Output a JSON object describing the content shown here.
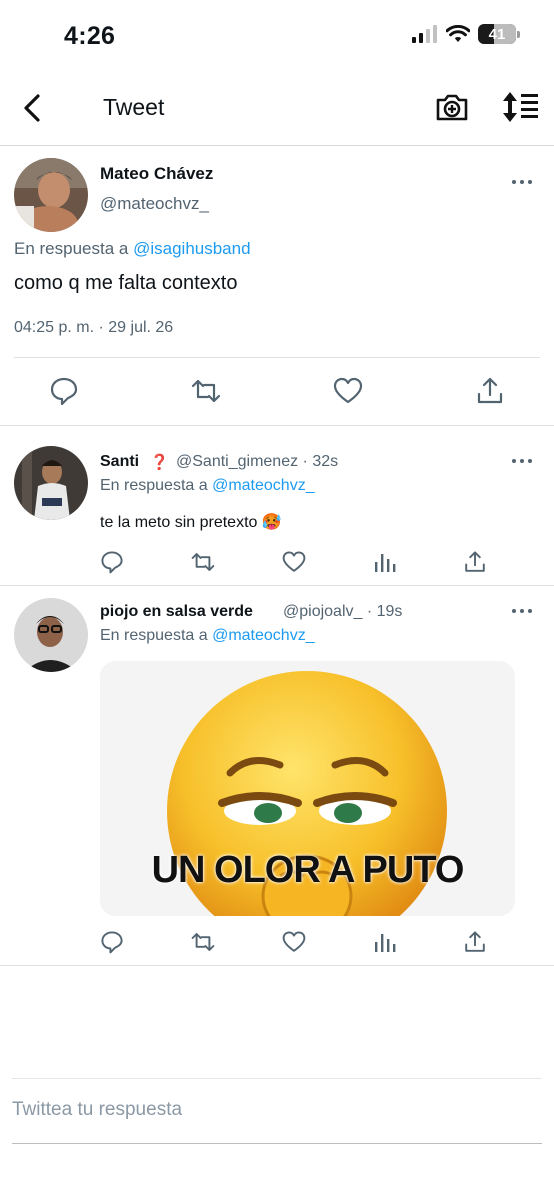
{
  "status_bar": {
    "time": "4:26",
    "battery": "41",
    "battery_level": 0.41
  },
  "nav": {
    "title": "Tweet",
    "icons": [
      "back-arrow-icon",
      "camera-plus-icon",
      "sort-icon"
    ]
  },
  "main_tweet": {
    "name": "Mateo Chávez",
    "handle": "@mateochvz_",
    "reply_prefix": "En respuesta a",
    "reply_to": "@isagihusband",
    "text": "como q me falta contexto",
    "timestamp": "04:25 p. m. · 29 jul. 26"
  },
  "replies": [
    {
      "name": "Santi",
      "badge": "❓",
      "handle": "@Santi_gimenez",
      "time": "· 32s",
      "reply_prefix": "En respuesta a",
      "reply_to": "@mateochvz_",
      "text": "te la meto sin pretexto 🥵"
    },
    {
      "name": "piojo en salsa verde",
      "handle": "@piojoalv_",
      "time": "· 19s",
      "reply_prefix": "En respuesta a",
      "reply_to": "@mateochvz_",
      "image_caption": "UN OLOR A PUTO"
    }
  ],
  "compose": {
    "placeholder": "Twittea tu respuesta"
  }
}
